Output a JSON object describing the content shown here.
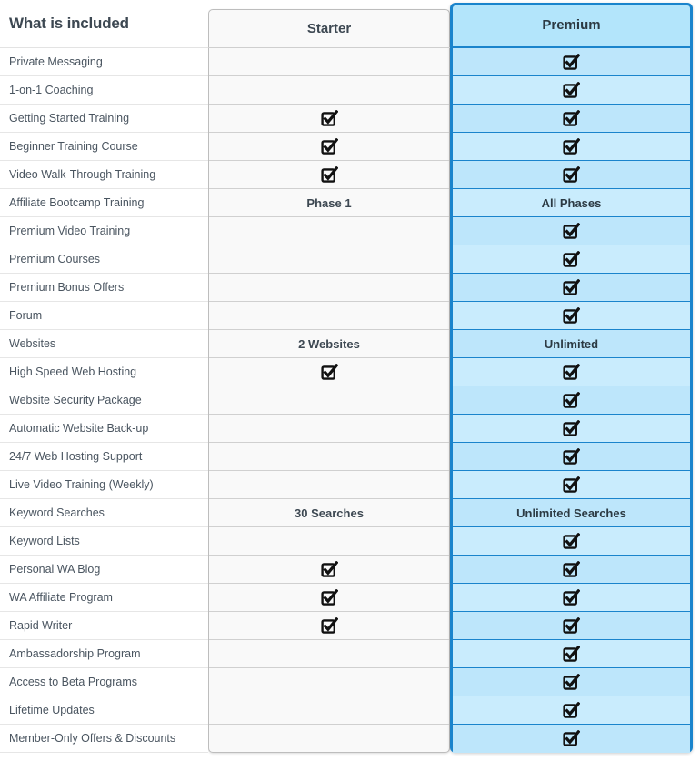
{
  "table": {
    "features_header": "What is included",
    "columns": [
      {
        "id": "starter",
        "label": "Starter",
        "highlighted": false
      },
      {
        "id": "premium",
        "label": "Premium",
        "highlighted": true
      }
    ],
    "check_icon": "checked-box-icon",
    "colors": {
      "premium_fill": "#b3e5fb",
      "premium_row_fill": "#c9ecfd",
      "premium_border": "#1a84cc",
      "starter_fill": "#f9f9f9",
      "starter_border": "#bdbdbd",
      "feature_text": "#4a5560",
      "header_text": "#3d4852",
      "row_divider": "#e6e6e6"
    },
    "rows": [
      {
        "feature": "Private Messaging",
        "starter": "",
        "premium": "check"
      },
      {
        "feature": "1-on-1 Coaching",
        "starter": "",
        "premium": "check"
      },
      {
        "feature": "Getting Started Training",
        "starter": "check",
        "premium": "check"
      },
      {
        "feature": "Beginner Training Course",
        "starter": "check",
        "premium": "check"
      },
      {
        "feature": "Video Walk-Through Training",
        "starter": "check",
        "premium": "check"
      },
      {
        "feature": "Affiliate Bootcamp Training",
        "starter": "Phase 1",
        "premium": "All Phases"
      },
      {
        "feature": "Premium Video Training",
        "starter": "",
        "premium": "check"
      },
      {
        "feature": "Premium Courses",
        "starter": "",
        "premium": "check"
      },
      {
        "feature": "Premium Bonus Offers",
        "starter": "",
        "premium": "check"
      },
      {
        "feature": "Forum",
        "starter": "",
        "premium": "check"
      },
      {
        "feature": "Websites",
        "starter": "2 Websites",
        "premium": "Unlimited"
      },
      {
        "feature": "High Speed Web Hosting",
        "starter": "check",
        "premium": "check"
      },
      {
        "feature": "Website Security Package",
        "starter": "",
        "premium": "check"
      },
      {
        "feature": "Automatic Website Back-up",
        "starter": "",
        "premium": "check"
      },
      {
        "feature": "24/7 Web Hosting Support",
        "starter": "",
        "premium": "check"
      },
      {
        "feature": "Live Video Training (Weekly)",
        "starter": "",
        "premium": "check"
      },
      {
        "feature": "Keyword Searches",
        "starter": "30 Searches",
        "premium": "Unlimited Searches"
      },
      {
        "feature": "Keyword Lists",
        "starter": "",
        "premium": "check"
      },
      {
        "feature": "Personal WA Blog",
        "starter": "check",
        "premium": "check"
      },
      {
        "feature": "WA Affiliate Program",
        "starter": "check",
        "premium": "check"
      },
      {
        "feature": "Rapid Writer",
        "starter": "check",
        "premium": "check"
      },
      {
        "feature": "Ambassadorship Program",
        "starter": "",
        "premium": "check"
      },
      {
        "feature": "Access to Beta Programs",
        "starter": "",
        "premium": "check"
      },
      {
        "feature": "Lifetime Updates",
        "starter": "",
        "premium": "check"
      },
      {
        "feature": "Member-Only Offers & Discounts",
        "starter": "",
        "premium": "check"
      }
    ]
  }
}
